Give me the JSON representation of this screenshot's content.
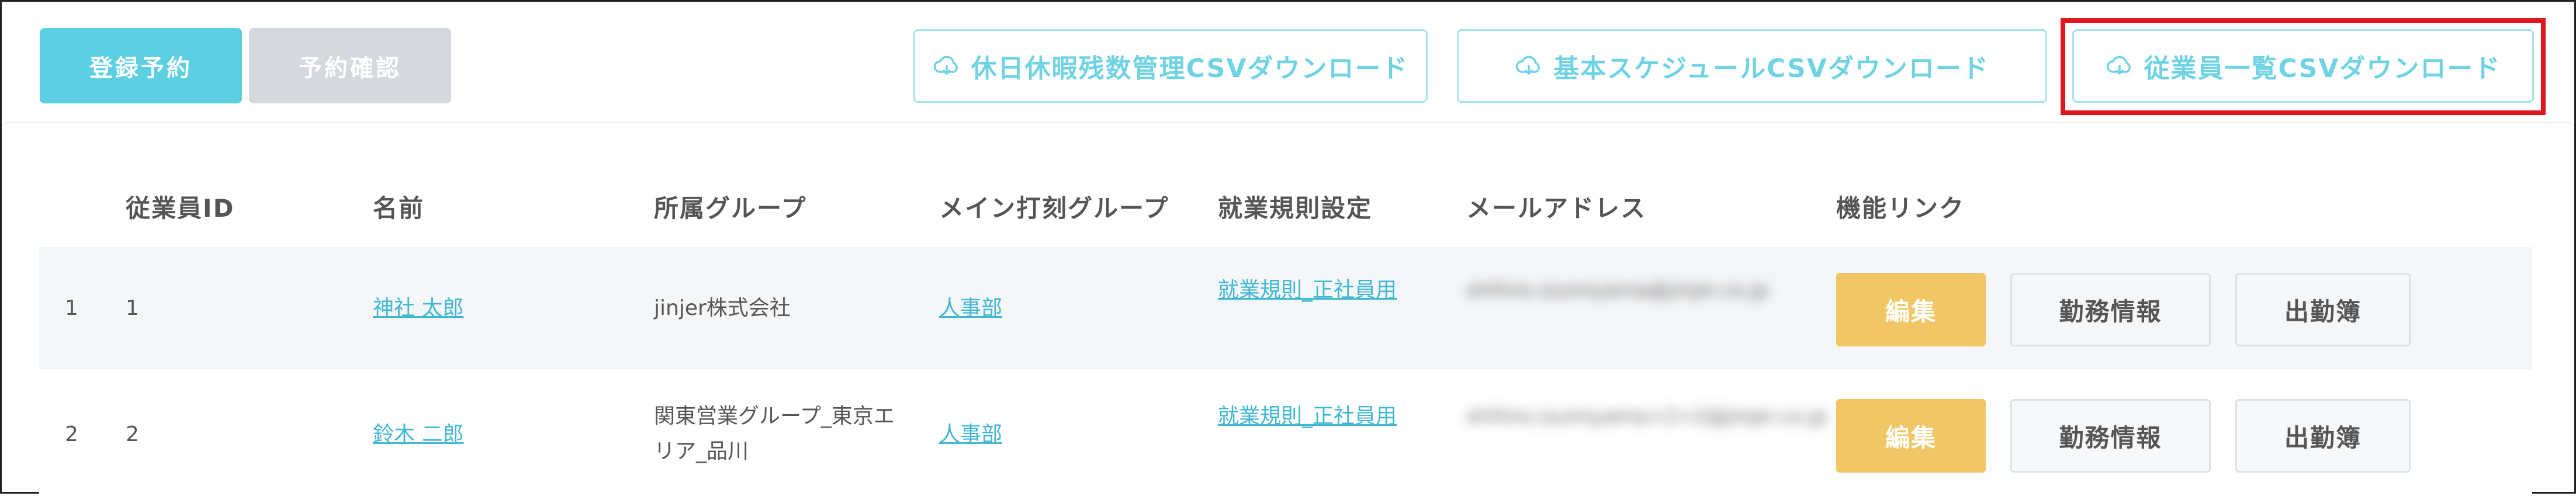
{
  "toolbar": {
    "register_label": "登録予約",
    "confirm_label": "予約確認",
    "csv_buttons": [
      {
        "label": "休日休暇残数管理CSVダウンロード",
        "icon": "cloud-download-icon"
      },
      {
        "label": "基本スケジュールCSVダウンロード",
        "icon": "cloud-download-icon"
      },
      {
        "label": "従業員一覧CSVダウンロード",
        "icon": "cloud-download-icon"
      }
    ]
  },
  "colors": {
    "primary": "#5ccfe3",
    "secondary": "#d5d8dc",
    "edit": "#f1c766",
    "link": "#3fb7d3",
    "highlight": "#e0161f"
  },
  "table": {
    "columns": [
      "従業員ID",
      "名前",
      "所属グループ",
      "メイン打刻グループ",
      "就業規則設定",
      "メールアドレス",
      "機能リンク"
    ],
    "rows": [
      {
        "index": "1",
        "employee_id": "1",
        "name": "神社 太郎",
        "group": "jinjer株式会社",
        "stamp_group": "人事部",
        "rule": "就業規則_正社員用",
        "email": "shihiro.izumiyama@jinjer.co.jp",
        "edit_label": "編集",
        "duty_label": "勤務情報",
        "attendance_label": "出勤簿"
      },
      {
        "index": "2",
        "employee_id": "2",
        "name": "鈴木 二郎",
        "group": "関東営業グループ_東京エリア_品川",
        "stamp_group": "人事部",
        "rule": "就業規則_正社員用",
        "email": "shihiro.izumiyama+2+2@jinjer.co.jp",
        "edit_label": "編集",
        "duty_label": "勤務情報",
        "attendance_label": "出勤簿"
      }
    ]
  }
}
